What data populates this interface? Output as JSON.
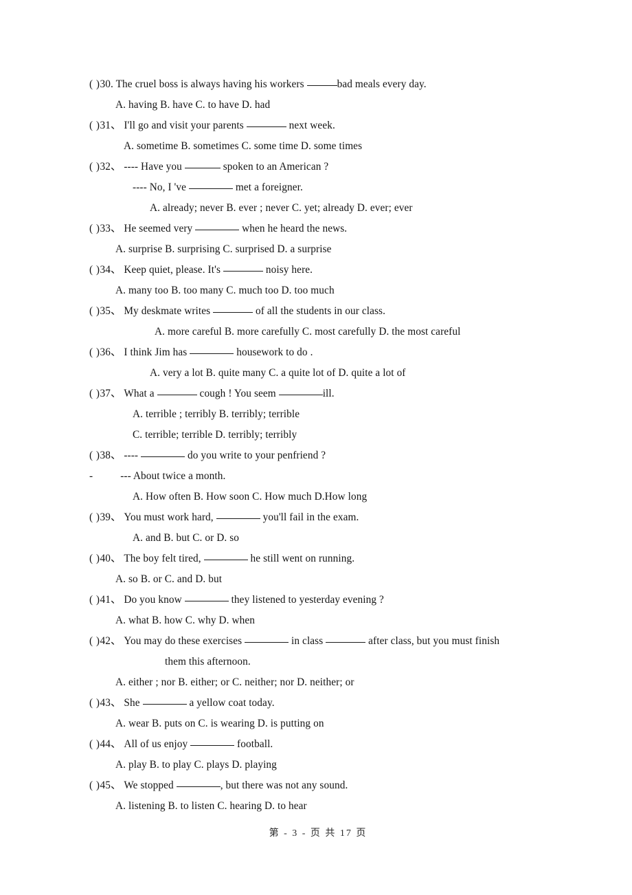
{
  "document": {
    "type": "exam-paper",
    "language": "English grammar multiple choice",
    "page_label": "第 - 3 - 页 共 17 页",
    "page_number": 3,
    "total_pages": 17
  },
  "questions": [
    {
      "bracket": "(    )",
      "number": "30.",
      "stem_before": " The cruel boss is always having his workers ",
      "stem_after": "bad meals every day.",
      "options_line": "A. having      B. have     C. to have    D. had"
    },
    {
      "bracket": "(    )",
      "number": "31、",
      "stem_before": " I'll go and visit your parents ",
      "stem_after": " next week.",
      "options_line": "A. sometime     B. sometimes     C. some time     D. some times"
    },
    {
      "bracket": "(    )",
      "number": "32、",
      "stem_before": " ---- Have you ",
      "stem_after": " spoken to an American ?",
      "continuation_before": "---- No, I 've ",
      "continuation_after": " met a foreigner.",
      "options_line": "A. already; never  B. ever ; never    C. yet; already     D. ever; ever"
    },
    {
      "bracket": "(    )",
      "number": "33、",
      "stem_before": " He seemed very ",
      "stem_after": " when he heard the news.",
      "options_line": "A. surprise      B. surprising     C. surprised    D. a surprise"
    },
    {
      "bracket": "(    )",
      "number": "34、",
      "stem_before": " Keep quiet, please. It's ",
      "stem_after": " noisy here.",
      "options_line": "A. many too      B. too many      C. much too    D. too much"
    },
    {
      "bracket": "(    )",
      "number": "35、",
      "stem_before": " My deskmate writes ",
      "stem_after": " of all the students in our class.",
      "options_line": "A. more careful  B. more carefully  C. most carefully  D. the most careful"
    },
    {
      "bracket": "(    )",
      "number": "36、",
      "stem_before": " I think Jim has ",
      "stem_after": " housework to do .",
      "options_line": "A. very a lot  B. quite many   C. a quite lot of     D. quite a lot of"
    },
    {
      "bracket": "(    )",
      "number": "37、",
      "stem_before": " What a ",
      "stem_mid": " cough ! You seem ",
      "stem_after": "ill.",
      "options_line_1": "A. terrible ; terribly            B. terribly; terrible",
      "options_line_2": "C. terrible; terrible            D. terribly; terribly"
    },
    {
      "bracket": "(    )",
      "number": "38、",
      "stem_before": " ---- ",
      "stem_after": " do you write to your penfriend ?",
      "reply_dash": "-",
      "reply_text": "--- About twice a month.",
      "options_line": "A. How often     B. How soon    C. How much   D.How long"
    },
    {
      "bracket": "(    )",
      "number": "39、",
      "stem_before": " You must work hard, ",
      "stem_after": " you'll fail in the exam.",
      "options_line": "A. and         B. but        C. or          D. so"
    },
    {
      "bracket": "(    )",
      "number": "40、",
      "stem_before": " The boy felt tired, ",
      "stem_after": " he still went on running.",
      "options_line": "A. so       B. or       C. and       D. but"
    },
    {
      "bracket": "(    )",
      "number": "41、",
      "stem_before": " Do you know ",
      "stem_after": " they listened to yesterday evening ?",
      "options_line": "A. what     B. how      C. why      D. when"
    },
    {
      "bracket": "(    )",
      "number": "42、",
      "stem_before": " You may do these exercises ",
      "stem_mid": " in class ",
      "stem_after": " after class, but you must finish",
      "continuation": "them this afternoon.",
      "options_line": "A. either ; nor   B. either; or    C. neither; nor   D. neither; or"
    },
    {
      "bracket": "(    )",
      "number": "43、",
      "stem_before": " She ",
      "stem_after": " a yellow coat today.",
      "options_line": "A. wear       B. puts on     C. is wearing     D. is putting on"
    },
    {
      "bracket": "(    )",
      "number": "44、",
      "stem_before": " All of us enjoy ",
      "stem_after": " football.",
      "options_line": "A. play       B. to play     C. plays        D. playing"
    },
    {
      "bracket": "(    )",
      "number": "45、",
      "stem_before": " We stopped ",
      "stem_after": ", but there was not any sound.",
      "options_line": "A. listening    B. to listen     C. hearing       D. to hear"
    }
  ]
}
